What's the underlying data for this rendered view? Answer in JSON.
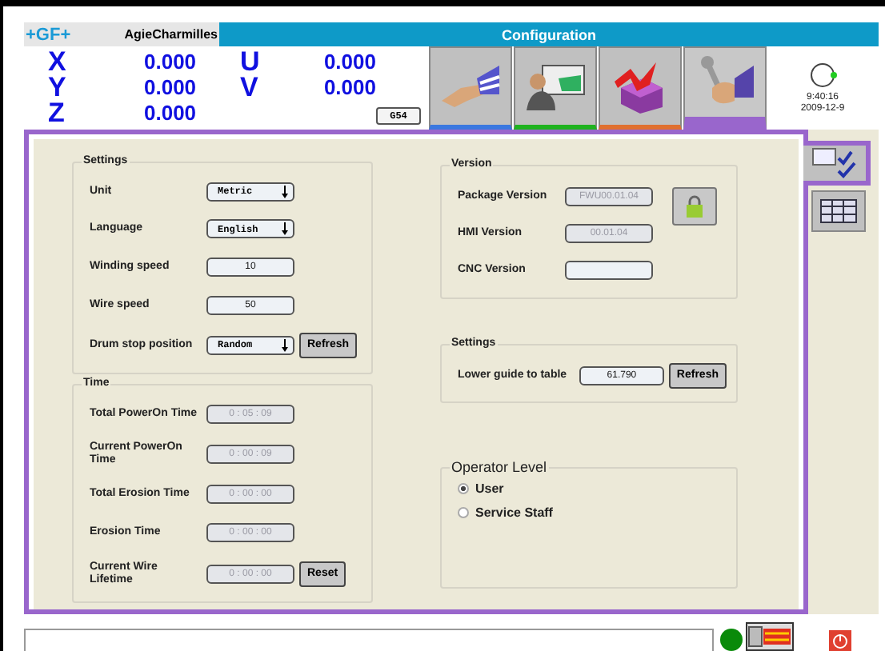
{
  "header": {
    "brand": "+GF+",
    "company": "AgieCharmilles",
    "title": "Configuration"
  },
  "axes": [
    [
      {
        "name": "X",
        "value": "0.000"
      },
      {
        "name": "Y",
        "value": "0.000"
      },
      {
        "name": "Z",
        "value": "0.000"
      }
    ],
    [
      {
        "name": "U",
        "value": "0.000"
      },
      {
        "name": "V",
        "value": "0.000"
      }
    ]
  ],
  "offset_button": "G54",
  "tabs": [
    {
      "kind": "hand",
      "color": "#3a78e0",
      "selected": false
    },
    {
      "kind": "operator",
      "color": "#1fb31f",
      "selected": false
    },
    {
      "kind": "part",
      "color": "#e07030",
      "selected": false
    },
    {
      "kind": "tools",
      "color": "#9966cc",
      "selected": true
    }
  ],
  "clock": {
    "time": "9:40:16",
    "date": "2009-12-9"
  },
  "side_tabs": [
    {
      "kind": "checklist",
      "selected": true
    },
    {
      "kind": "table",
      "selected": false
    }
  ],
  "settings": {
    "title": "Settings",
    "rows": [
      {
        "label": "Unit",
        "kind": "select",
        "value": "Metric"
      },
      {
        "label": "Language",
        "kind": "select",
        "value": "English"
      },
      {
        "label": "Winding speed",
        "kind": "input",
        "value": "10"
      },
      {
        "label": "Wire speed",
        "kind": "input",
        "value": "50"
      },
      {
        "label": "Drum stop position",
        "kind": "select",
        "value": "Random",
        "button": "Refresh"
      }
    ]
  },
  "time": {
    "title": "Time",
    "rows": [
      {
        "label": "Total PowerOn Time",
        "value": "0 : 05 : 09",
        "disabled": true
      },
      {
        "label": "Current PowerOn Time",
        "value": "0 : 00 : 09",
        "disabled": true
      },
      {
        "label": "Total Erosion Time",
        "value": "0 : 00 : 00",
        "disabled": true
      },
      {
        "label": "Erosion Time",
        "value": "0 : 00 : 00",
        "disabled": true
      },
      {
        "label": "Current Wire Lifetime",
        "value": "0 : 00 : 00",
        "disabled": true,
        "button": "Reset"
      }
    ]
  },
  "version": {
    "title": "Version",
    "rows": [
      {
        "label": "Package Version",
        "value": "FWU00.01.04",
        "disabled": true
      },
      {
        "label": "HMI Version",
        "value": "00.01.04",
        "disabled": true
      },
      {
        "label": "CNC Version"
      }
    ]
  },
  "machine_settings": {
    "title": "Settings",
    "rows": [
      {
        "label": "Lower guide to table",
        "value": "61.790",
        "disabled": false,
        "button": "Refresh"
      }
    ]
  },
  "operator_level": {
    "title": "Operator Level",
    "options": [
      {
        "label": "User",
        "selected": true
      },
      {
        "label": "Service Staff",
        "selected": false
      }
    ]
  }
}
